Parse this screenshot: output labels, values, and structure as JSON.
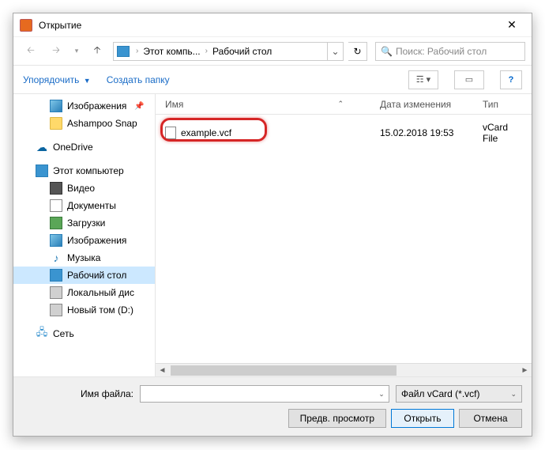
{
  "title": "Открытие",
  "breadcrumb": {
    "root": "Этот компь...",
    "current": "Рабочий стол"
  },
  "search": {
    "placeholder": "Поиск: Рабочий стол"
  },
  "toolbar": {
    "organize": "Упорядочить",
    "new_folder": "Создать папку"
  },
  "tree": {
    "pictures": "Изображения",
    "ashampoo": "Ashampoo Snap",
    "onedrive": "OneDrive",
    "this_pc": "Этот компьютер",
    "video": "Видео",
    "documents": "Документы",
    "downloads": "Загрузки",
    "images2": "Изображения",
    "music": "Музыка",
    "desktop": "Рабочий стол",
    "local_disk": "Локальный дис",
    "new_vol": "Новый том (D:)",
    "network": "Сеть"
  },
  "columns": {
    "name": "Имя",
    "date": "Дата изменения",
    "type": "Тип"
  },
  "file": {
    "name": "example.vcf",
    "date": "15.02.2018 19:53",
    "type": "vCard File"
  },
  "bottom": {
    "filename_label": "Имя файла:",
    "filename_value": "",
    "filter": "Файл vCard (*.vcf)",
    "preview": "Предв. просмотр",
    "open": "Открыть",
    "cancel": "Отмена"
  }
}
